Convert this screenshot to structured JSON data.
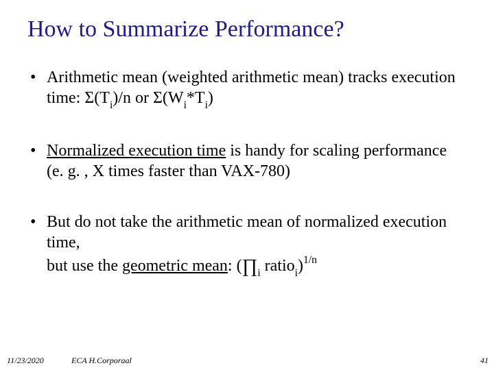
{
  "title": "How to Summarize Performance?",
  "bullet1": {
    "pre": "Arithmetic mean (weighted arithmetic mean) tracks execution time: Σ(T",
    "sub1": "i",
    "mid": ")/n or Σ(W",
    "sub2": "i",
    "mid2": "*T",
    "sub3": "i",
    "post": ")"
  },
  "bullet2": {
    "underlined": "Normalized execution time",
    "rest": " is handy for scaling performance (e. g. , X times faster than VAX-780)"
  },
  "bullet3": {
    "pre": "But do not take the arithmetic mean of normalized execution time,",
    "line2a": "but use the ",
    "underlined": "geometric mean",
    "after_u": ": (",
    "prod": "∏",
    "sub1": "i",
    "mid": " ratio",
    "sub2": "i",
    "close": ")",
    "sup": "1/n"
  },
  "footer": {
    "date": "11/23/2020",
    "center": "ECA  H.Corporaal",
    "page": "41"
  }
}
